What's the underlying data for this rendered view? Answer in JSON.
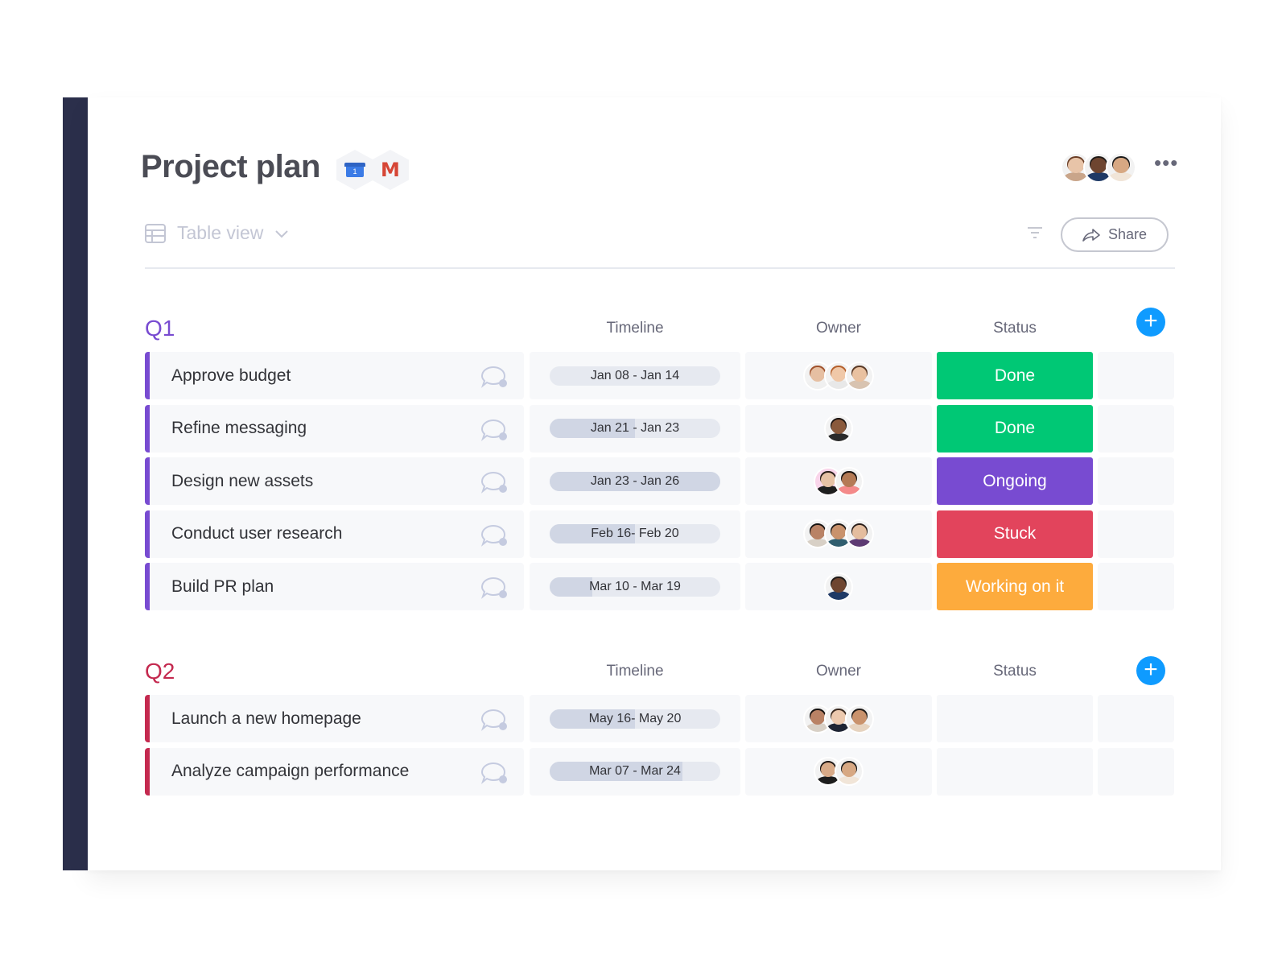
{
  "board": {
    "title": "Project plan",
    "integrations": [
      {
        "name": "google-calendar-icon",
        "label": "1"
      },
      {
        "name": "gmail-icon",
        "label": "M"
      }
    ],
    "more_label": "•••",
    "view": {
      "label": "Table view",
      "icon": "table-icon"
    },
    "share_label": "Share",
    "members": [
      {
        "skin": "#e8c4a8",
        "hair": "#6b3e26",
        "shirt": "#c9a58a"
      },
      {
        "skin": "#6e4530",
        "hair": "#1f1a17",
        "shirt": "#1f3a66"
      },
      {
        "skin": "#d7a883",
        "hair": "#1a1a1a",
        "shirt": "#f1e5d8"
      }
    ]
  },
  "colors": {
    "q1": "#784bd1",
    "q2": "#c4294f",
    "done": "#00c875",
    "ongoing": "#784bd1",
    "stuck": "#e2445c",
    "working": "#fdab3d",
    "accent": "#0f9bff"
  },
  "groups": [
    {
      "title": "Q1",
      "color_key": "q1",
      "columns": {
        "timeline": "Timeline",
        "owner": "Owner",
        "status": "Status"
      },
      "rows": [
        {
          "task": "Approve budget",
          "timeline": "Jan 08 - Jan 14",
          "progress": 0.0,
          "status": "Done",
          "status_color": "#00c875",
          "owners": [
            {
              "skin": "#e6bfa2",
              "hair": "#a0522d",
              "shirt": "#f0f0f0"
            },
            {
              "skin": "#f0c8a8",
              "hair": "#b5602c",
              "shirt": "#e8e8e8"
            },
            {
              "skin": "#e9c1a0",
              "hair": "#5b3a26",
              "shirt": "#d8c3b0"
            }
          ]
        },
        {
          "task": "Refine messaging",
          "timeline": "Jan 21 - Jan 23",
          "progress": 0.5,
          "status": "Done",
          "status_color": "#00c875",
          "owners": [
            {
              "skin": "#8a5a3c",
              "hair": "#1b1411",
              "shirt": "#2a2a2a"
            }
          ]
        },
        {
          "task": "Design new assets",
          "timeline": "Jan 23 - Jan 26",
          "progress": 1.0,
          "status": "Ongoing",
          "status_color": "#784bd1",
          "owners": [
            {
              "skin": "#e7c2a5",
              "hair": "#2b1f1a",
              "shirt": "#1e1e1e",
              "bg": "#f9d5ea"
            },
            {
              "skin": "#b47a55",
              "hair": "#1b1411",
              "shirt": "#f48a8a"
            }
          ]
        },
        {
          "task": "Conduct user research",
          "timeline": "Feb 16- Feb 20",
          "progress": 0.5,
          "status": "Stuck",
          "status_color": "#e2445c",
          "owners": [
            {
              "skin": "#b98265",
              "hair": "#161210",
              "shirt": "#d8d0c6"
            },
            {
              "skin": "#c9926c",
              "hair": "#1f1a17",
              "shirt": "#2f5d6e"
            },
            {
              "skin": "#e4bd9e",
              "hair": "#2a1f1a",
              "shirt": "#5d3a73"
            }
          ]
        },
        {
          "task": "Build PR plan",
          "timeline": "Mar 10 - Mar 19",
          "progress": 0.25,
          "status": "Working on it",
          "status_color": "#fdab3d",
          "owners": [
            {
              "skin": "#6e4530",
              "hair": "#1f1a17",
              "shirt": "#1f3a66"
            }
          ]
        }
      ]
    },
    {
      "title": "Q2",
      "color_key": "q2",
      "columns": {
        "timeline": "Timeline",
        "owner": "Owner",
        "status": "Status"
      },
      "rows": [
        {
          "task": "Launch a new homepage",
          "timeline": "May 16- May 20",
          "progress": 0.5,
          "status": "",
          "status_color": "",
          "owners": [
            {
              "skin": "#b98265",
              "hair": "#161210",
              "shirt": "#d8d0c6"
            },
            {
              "skin": "#ecc9ae",
              "hair": "#3a2a20",
              "shirt": "#1e2433"
            },
            {
              "skin": "#c9926c",
              "hair": "#1f1a17",
              "shirt": "#e6d3bf"
            }
          ]
        },
        {
          "task": "Analyze campaign performance",
          "timeline": "Mar 07 - Mar 24",
          "progress": 0.78,
          "status": "",
          "status_color": "",
          "owners": [
            {
              "skin": "#d8aa88",
              "hair": "#1b1411",
              "shirt": "#1d1d1d"
            },
            {
              "skin": "#d7a883",
              "hair": "#1a1a1a",
              "shirt": "#f1e5d8"
            }
          ]
        }
      ]
    }
  ]
}
